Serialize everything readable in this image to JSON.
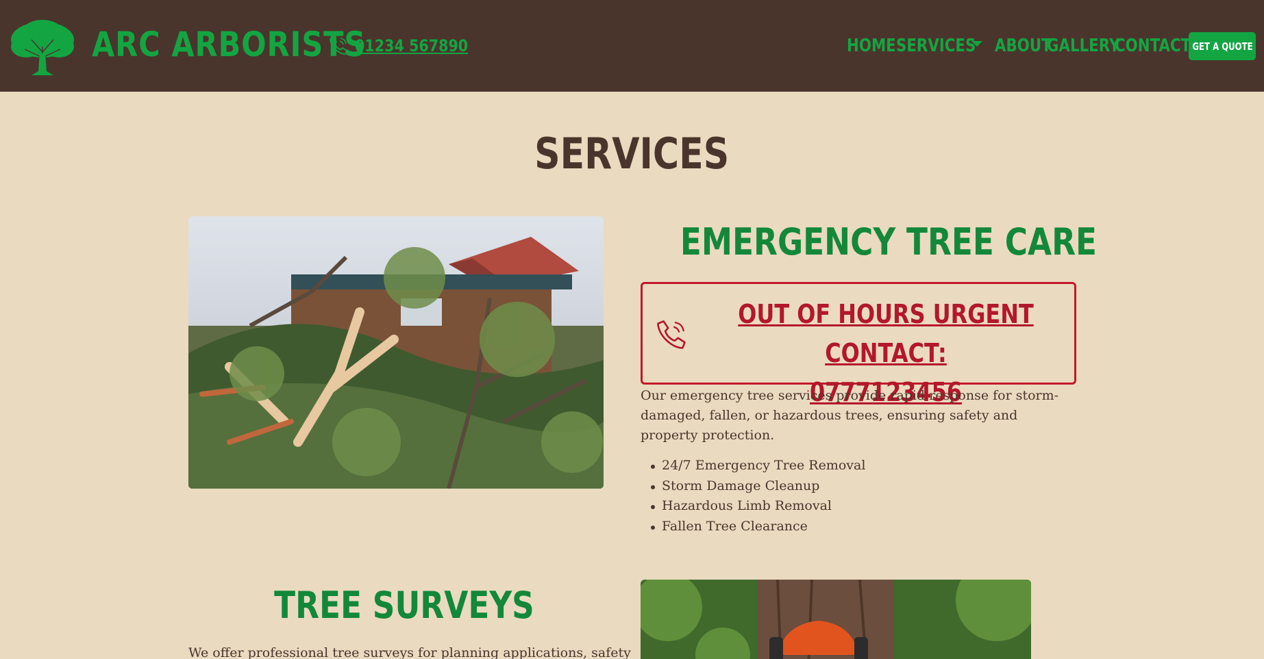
{
  "header": {
    "brand": "ARC ARBORISTS",
    "phone": "01234 567890",
    "nav": [
      {
        "label": "HOME"
      },
      {
        "label": "SERVICES"
      },
      {
        "label": "ABOUT"
      },
      {
        "label": "GALLERY"
      },
      {
        "label": "CONTACT"
      }
    ],
    "quote_button": "GET A QUOTE"
  },
  "main": {
    "title": "SERVICES",
    "emergency": {
      "title": "EMERGENCY TREE CARE",
      "urgent_line1": "OUT OF HOURS URGENT CONTACT:",
      "urgent_line2": "0777123456",
      "description": "Our emergency tree services provide rapid response for storm-damaged, fallen, or hazardous trees, ensuring safety and property protection.",
      "features": [
        "24/7 Emergency Tree Removal",
        "Storm Damage Cleanup",
        "Hazardous Limb Removal",
        "Fallen Tree Clearance"
      ]
    },
    "surveys": {
      "title": "TREE SURVEYS",
      "description": "We offer professional tree surveys for planning applications, safety"
    }
  },
  "colors": {
    "header_bg": "#4a352c",
    "page_bg": "#eadac0",
    "brand_green": "#13a542",
    "heading_green": "#13883a",
    "urgent_red": "#c2182b"
  }
}
